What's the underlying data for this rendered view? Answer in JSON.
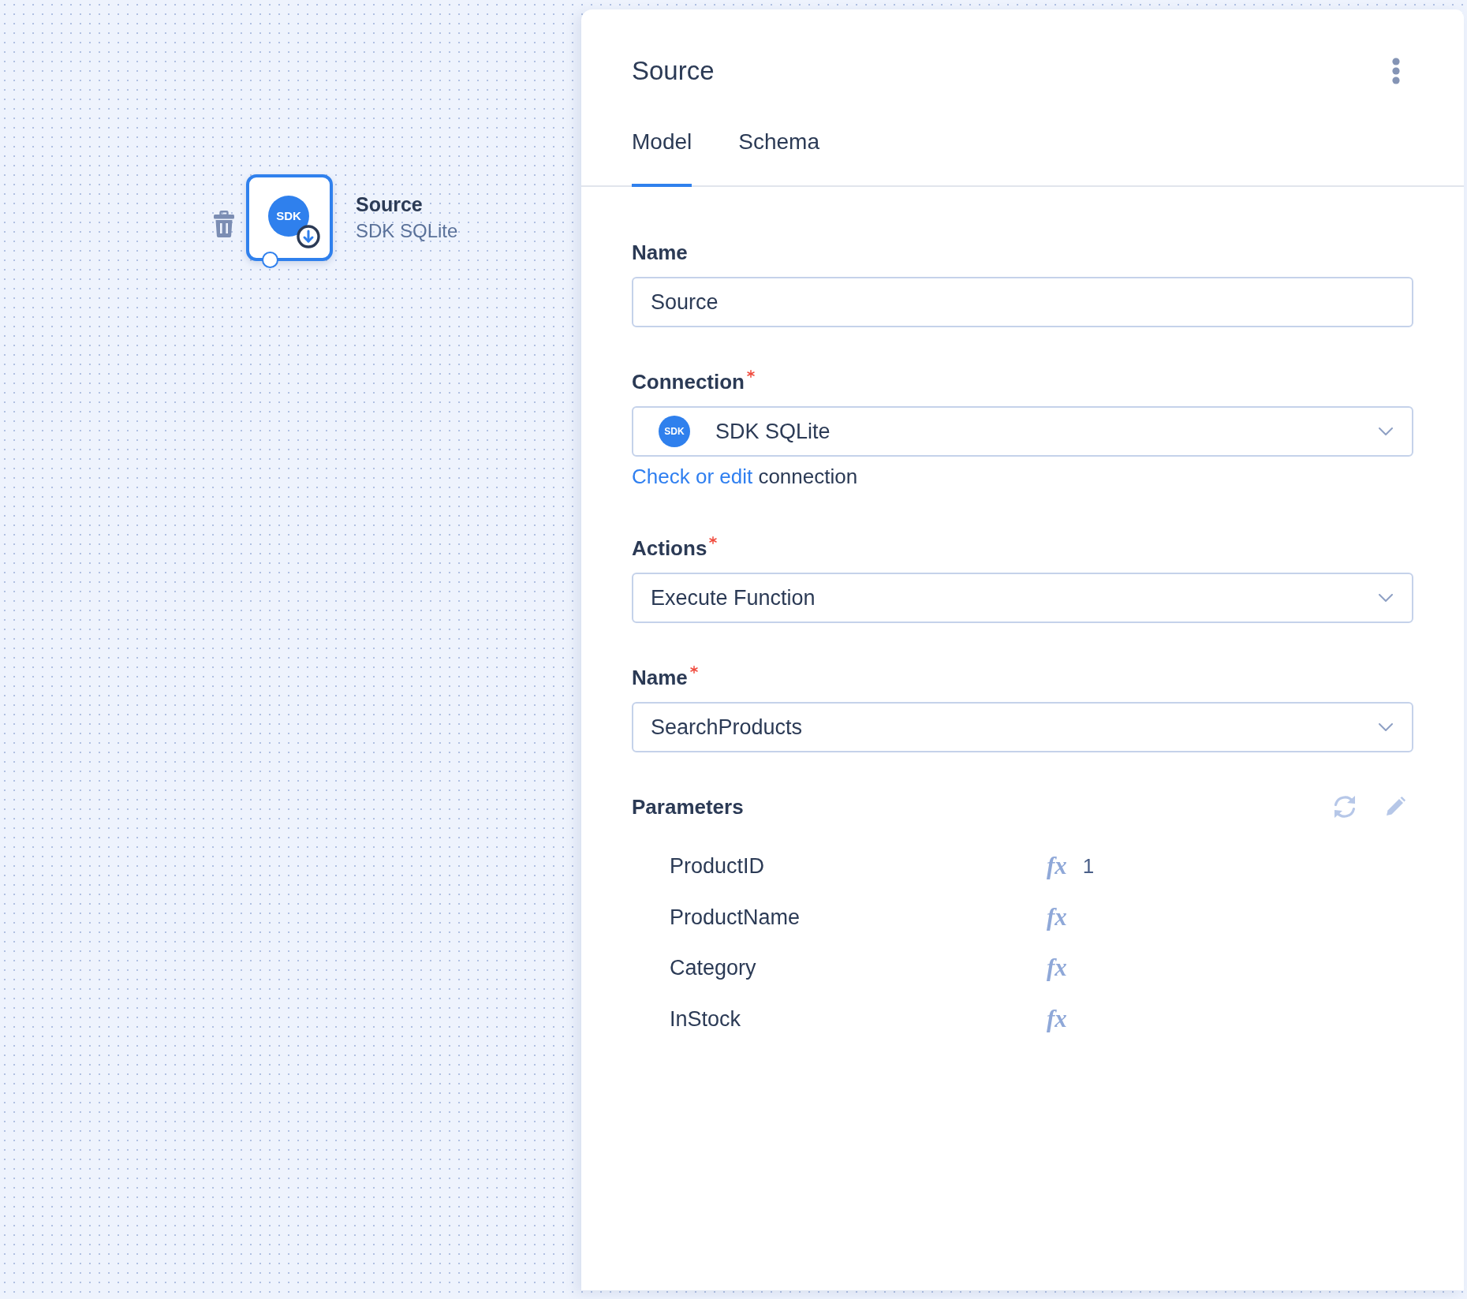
{
  "canvas": {
    "node": {
      "selected": true,
      "logo_text": "SDK",
      "title": "Source",
      "subtitle": "SDK SQLite"
    }
  },
  "panel": {
    "title": "Source",
    "tabs": [
      {
        "label": "Model",
        "selected": true
      },
      {
        "label": "Schema",
        "selected": false
      }
    ],
    "fields": [
      {
        "kind": "text",
        "label": "Name",
        "required": false,
        "value": "Source"
      },
      {
        "kind": "select",
        "label": "Connection",
        "required": true,
        "logo_text": "SDK",
        "value": "SDK SQLite",
        "hint": {
          "link": "Check or edit",
          "text": "connection"
        }
      },
      {
        "kind": "select",
        "label": "Actions",
        "required": true,
        "value": "Execute Function"
      },
      {
        "kind": "select",
        "label": "Name",
        "required": true,
        "value": "SearchProducts"
      }
    ],
    "parameters": {
      "title": "Parameters",
      "rows": [
        {
          "name": "ProductID",
          "mode": "fx",
          "value": "1"
        },
        {
          "name": "ProductName",
          "mode": "fx"
        },
        {
          "name": "Category",
          "mode": "fx"
        },
        {
          "name": "InStock",
          "mode": "fx"
        }
      ]
    }
  }
}
